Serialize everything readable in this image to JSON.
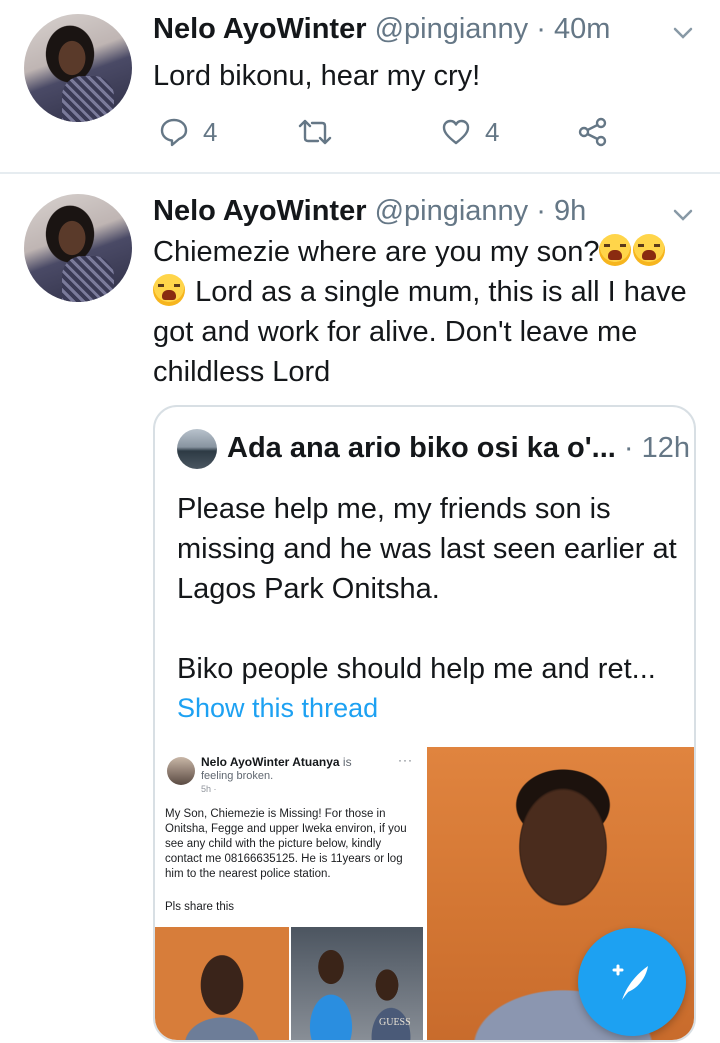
{
  "tweets": [
    {
      "name": "Nelo AyoWinter",
      "handle": "@pingianny",
      "separator": "·",
      "time": "40m",
      "text": "Lord bikonu, hear my cry!",
      "replies": "4",
      "likes": "4"
    },
    {
      "name": "Nelo AyoWinter",
      "handle": "@pingianny",
      "separator": "·",
      "time": "9h",
      "text_line1": "Chiemezie where are you my son?",
      "text_line2": "Lord as a single mum, this is all I have got and work for alive. Don't leave me childless Lord"
    }
  ],
  "quoted": {
    "name": "Ada ana ario biko osi ka o'...",
    "separator": "·",
    "time": "12h",
    "para1": "Please help me, my friends son is missing and he was last seen  earlier at Lagos Park Onitsha.",
    "para2": "Biko people should help me and ret...",
    "show_thread": "Show this thread"
  },
  "facebook_screenshot": {
    "name": "Nelo AyoWinter Atuanya",
    "is": "is",
    "feeling": "feeling broken.",
    "time": "5h ·",
    "post": "My Son, Chiemezie is Missing! For those in Onitsha, Fegge and upper Iweka environ, if you see any child with the picture below, kindly contact me 08166635125. He is 11years or log him to the nearest police station.",
    "share": "Pls share this",
    "more": "···",
    "shirt_text": "GUESS"
  },
  "icons": [
    "reply-icon",
    "retweet-icon",
    "like-icon",
    "share-icon",
    "caret-down-icon",
    "compose-tweet-icon"
  ],
  "colors": {
    "accent": "#1da1f2",
    "muted": "#657786",
    "divider": "#e6ecf0"
  }
}
